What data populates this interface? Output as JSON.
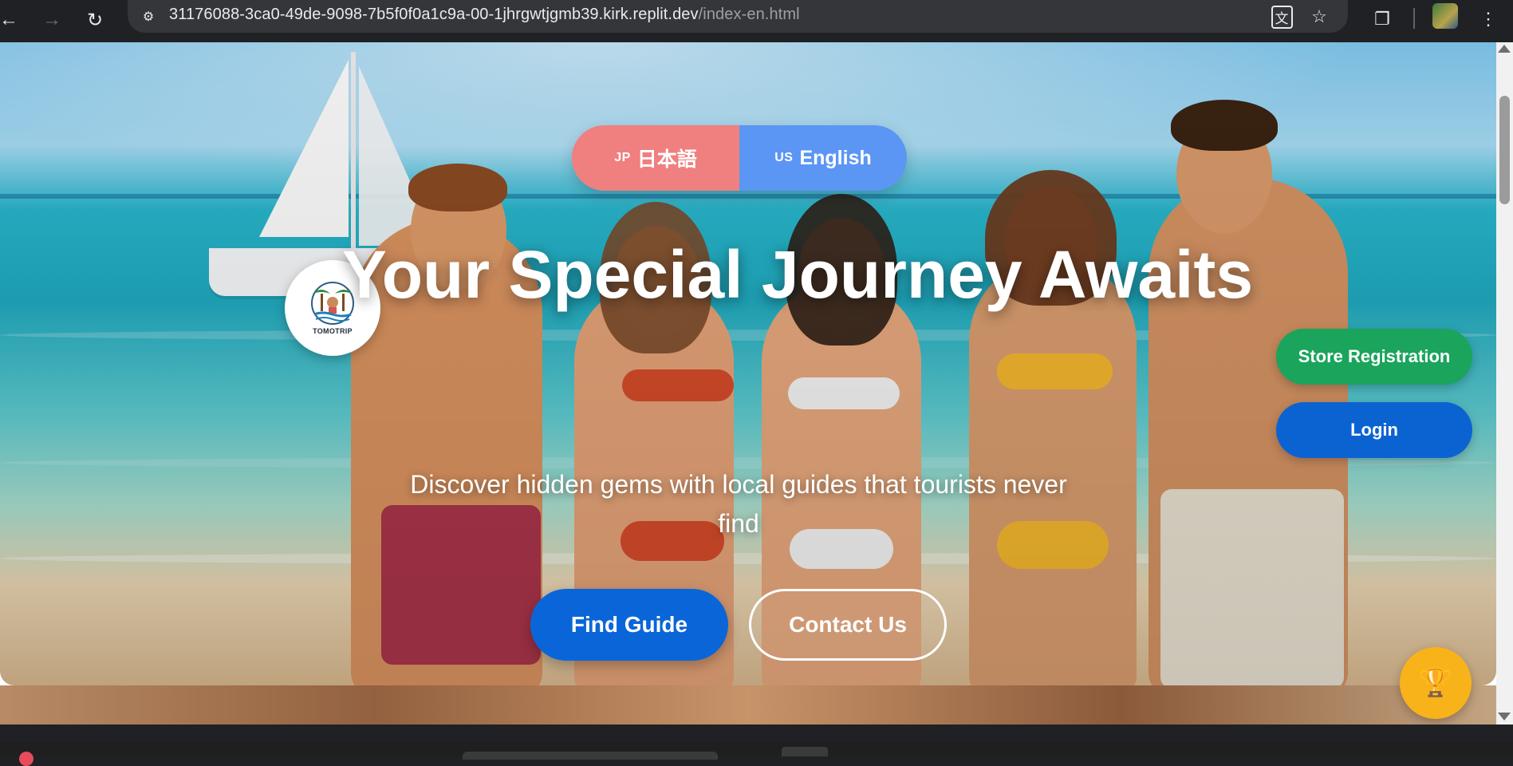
{
  "browser": {
    "url_host": "31176088-3ca0-49de-9098-7b5f0f0a1c9a-00-1jhrgwtjgmb39.kirk.replit.dev",
    "url_path": "/index-en.html",
    "icons": {
      "back": "arrow-left-icon",
      "forward": "arrow-right-icon",
      "reload": "reload-icon",
      "site_info": "tune-icon",
      "translate": "translate-icon",
      "bookmark": "star-icon",
      "extensions": "puzzle-icon",
      "menu": "more-vertical-icon"
    }
  },
  "language_switch": {
    "japanese": {
      "flag": "JP",
      "label": "日本語"
    },
    "english": {
      "flag": "US",
      "label": "English"
    }
  },
  "logo": {
    "text": "TOMOTRIP"
  },
  "hero": {
    "title": "Your Special Journey Awaits",
    "subtitle": "Discover hidden gems with local guides that tourists never find",
    "primary_button": "Find Guide",
    "secondary_button": "Contact Us"
  },
  "side_actions": {
    "store_registration": "Store Registration",
    "login": "Login"
  },
  "floating": {
    "trophy_icon": "trophy-icon"
  },
  "colors": {
    "lang_japanese": "#f07f7f",
    "lang_english": "#5b96f4",
    "primary_blue": "#0a66d8",
    "store_green": "#1ba45c",
    "trophy_gold": "#f8b31a"
  }
}
